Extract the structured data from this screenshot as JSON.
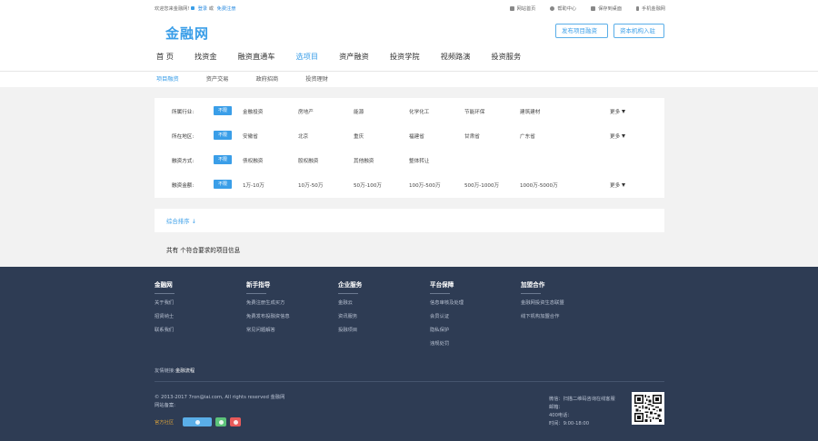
{
  "topbar": {
    "welcome": "欢迎您来金融网!",
    "login": "登录",
    "or": "或",
    "register": "免费注册",
    "links": [
      {
        "label": "网站首页",
        "icon": "home-icon"
      },
      {
        "label": "帮助中心",
        "icon": "help-icon"
      },
      {
        "label": "保存到桌面",
        "icon": "desktop-icon"
      },
      {
        "label": "手机金融网",
        "icon": "mobile-icon"
      }
    ]
  },
  "header": {
    "logo": "金融网",
    "btn_publish": "发布项目融资",
    "btn_investor": "资本机构入驻"
  },
  "nav": {
    "items": [
      "首 页",
      "找资金",
      "融资直通车",
      "选项目",
      "资产融资",
      "投资学院",
      "视频路演",
      "投资服务"
    ],
    "active_index": 3
  },
  "subnav": {
    "items": [
      "项目融资",
      "资产交易",
      "政府招商",
      "投资理财"
    ],
    "active_index": 0
  },
  "filters": [
    {
      "label": "所属行业:",
      "tag": "不限",
      "options": [
        "金融投资",
        "房地产",
        "能源",
        "化学化工",
        "节能环保",
        "建筑建材"
      ],
      "more": "更多"
    },
    {
      "label": "所在地区:",
      "tag": "不限",
      "options": [
        "安徽省",
        "北京",
        "重庆",
        "福建省",
        "甘肃省",
        "广东省"
      ],
      "more": "更多"
    },
    {
      "label": "融资方式:",
      "tag": "不限",
      "options": [
        "债权融资",
        "股权融资",
        "其他融资",
        "整体转让"
      ],
      "more": ""
    },
    {
      "label": "融资金额:",
      "tag": "不限",
      "options": [
        "1万-10万",
        "10万-50万",
        "50万-100万",
        "100万-500万",
        "500万-1000万",
        "1000万-5000万"
      ],
      "more": "更多"
    }
  ],
  "sort": {
    "label": "综合排序 ↓"
  },
  "result": {
    "text": "共有 个符合要求的项目信息"
  },
  "footer": {
    "columns": [
      {
        "title": "金融网",
        "items": [
          "关于我们",
          "招贤纳士",
          "联系我们"
        ]
      },
      {
        "title": "新手指导",
        "items": [
          "免费注册生成买方",
          "免费发布投融资信息",
          "常见问题解答"
        ]
      },
      {
        "title": "企业服务",
        "items": [
          "金融云",
          "资讯服务",
          "投融项目"
        ]
      },
      {
        "title": "平台保障",
        "items": [
          "信息审核及处理",
          "会员认证",
          "隐私保护",
          "违规处罚"
        ]
      },
      {
        "title": "加盟合作",
        "items": [
          "金融网投资生态联盟",
          "线下机构加盟合作"
        ]
      }
    ],
    "friend_link_label": "友情链接:",
    "friend_link": "金融流程",
    "copyright": "© 2013-2017 7ron@iai.com, All rights reserved 金融网",
    "site_record": "网站备案:",
    "official_label": "官方社区",
    "contact": [
      "微信：扫描二维码咨询在线客服",
      "邮箱：",
      "400电话：",
      "时间：9:00-18:00"
    ]
  }
}
